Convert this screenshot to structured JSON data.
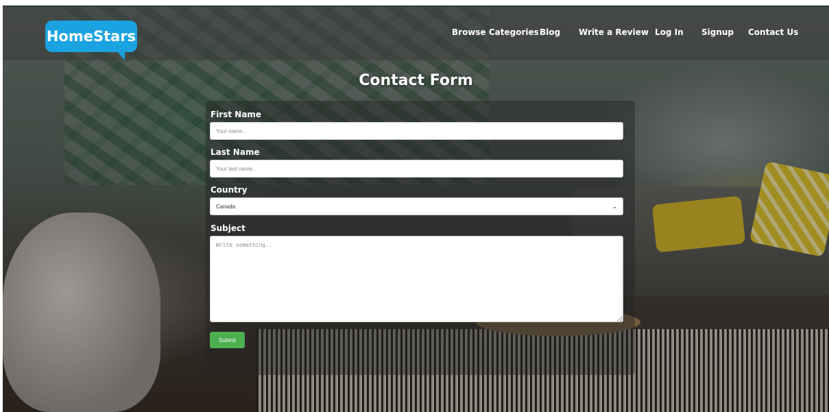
{
  "brand": {
    "name": "HomeStars",
    "color": "#1aa3e0"
  },
  "nav": {
    "items": [
      {
        "label": "Browse Categories"
      },
      {
        "label": "Blog"
      },
      {
        "label": "Write a Review"
      },
      {
        "label": "Log In"
      },
      {
        "label": "Signup"
      },
      {
        "label": "Contact Us"
      }
    ]
  },
  "page": {
    "title": "Contact Form"
  },
  "form": {
    "first_name": {
      "label": "First Name",
      "placeholder": "Your name.."
    },
    "last_name": {
      "label": "Last Name",
      "placeholder": "Your last name.."
    },
    "country": {
      "label": "Country",
      "selected": "Canada"
    },
    "subject": {
      "label": "Subject",
      "placeholder": "Write something.."
    },
    "submit_label": "Submit",
    "submit_color": "#4caf50"
  },
  "icons": {
    "select_arrow": "chevron-down-icon",
    "resize": "resize-grip-icon"
  }
}
